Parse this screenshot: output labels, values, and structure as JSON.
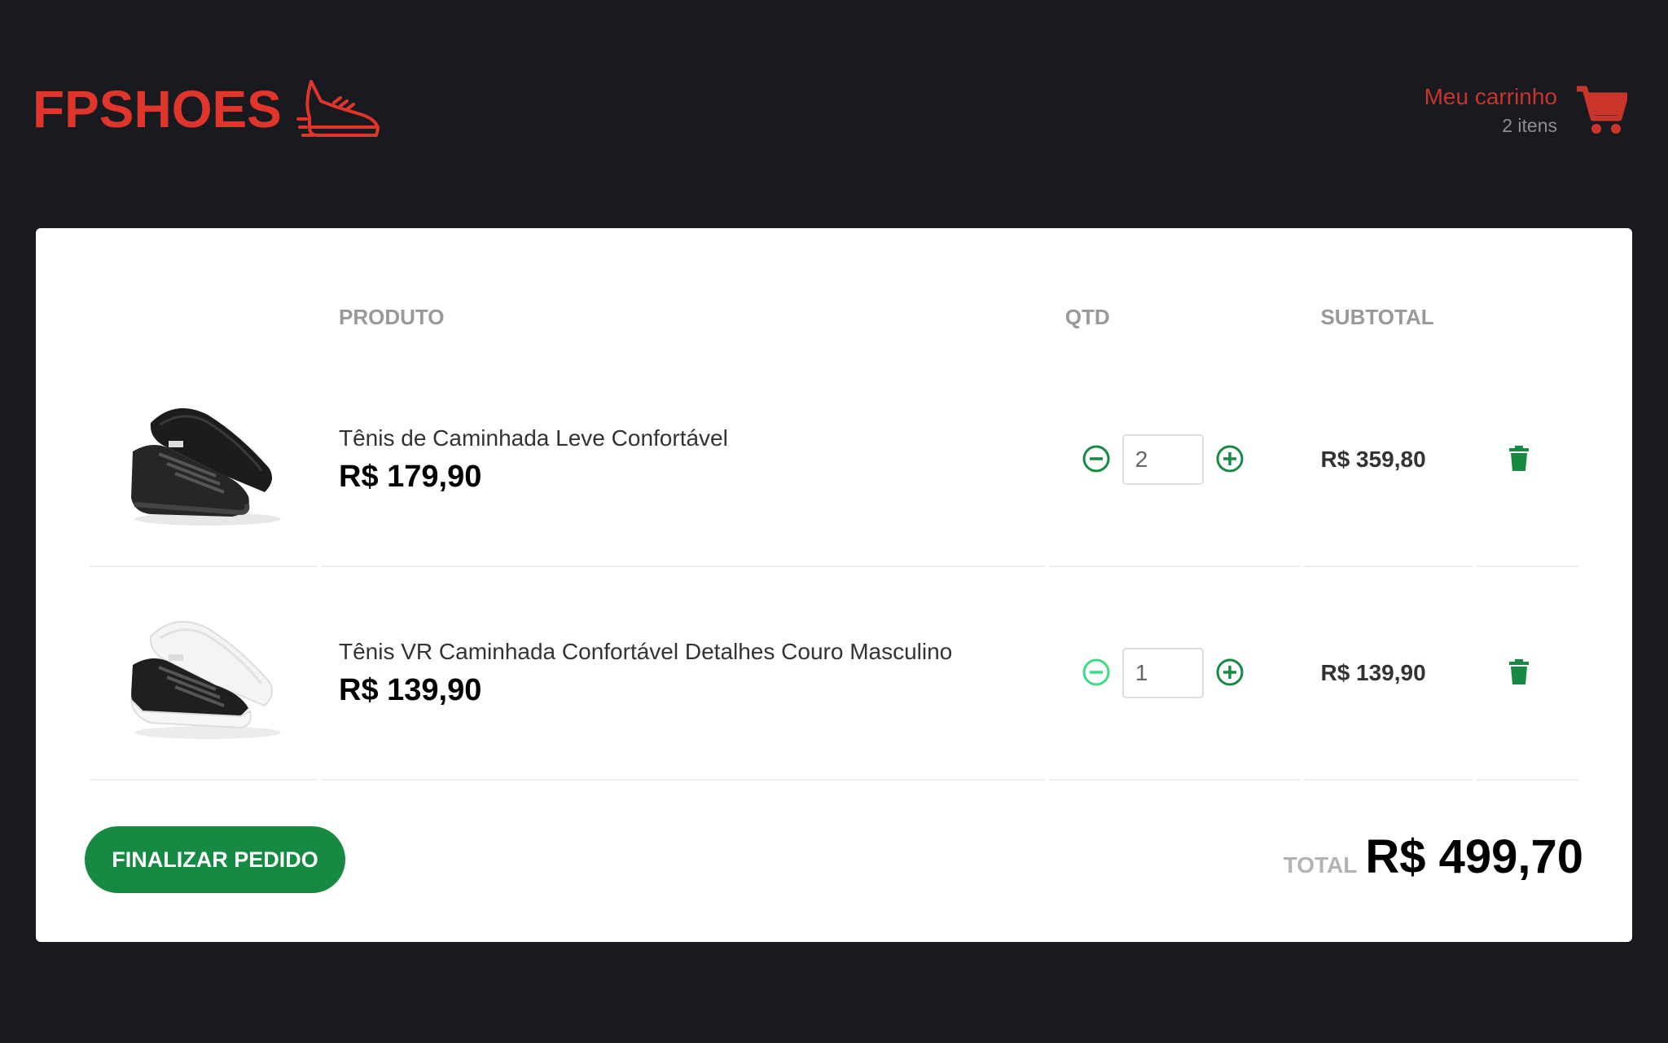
{
  "header": {
    "logo_text": "FPSHOES",
    "cart_title": "Meu carrinho",
    "cart_count": "2 itens"
  },
  "table": {
    "headers": {
      "product": "PRODUTO",
      "qty": "QTD",
      "subtotal": "SUBTOTAL"
    },
    "rows": [
      {
        "title": "Tênis de Caminhada Leve Confortável",
        "price": "R$ 179,90",
        "qty": "2",
        "subtotal": "R$ 359,80",
        "decrement_enabled": true
      },
      {
        "title": "Tênis VR Caminhada Confortável Detalhes Couro Masculino",
        "price": "R$ 139,90",
        "qty": "1",
        "subtotal": "R$ 139,90",
        "decrement_enabled": false
      }
    ]
  },
  "footer": {
    "finalize_label": "FINALIZAR PEDIDO",
    "total_label": "TOTAL",
    "total_value": "R$ 499,70"
  },
  "colors": {
    "brand_red": "#e0352b",
    "accent_green": "#168a43",
    "disabled_green": "#3ddc84",
    "background": "#191920"
  },
  "icons": {
    "logo": "running-shoe-icon",
    "cart": "shopping-cart-icon",
    "decrement": "minus-circle-icon",
    "increment": "plus-circle-icon",
    "delete": "trash-icon"
  }
}
